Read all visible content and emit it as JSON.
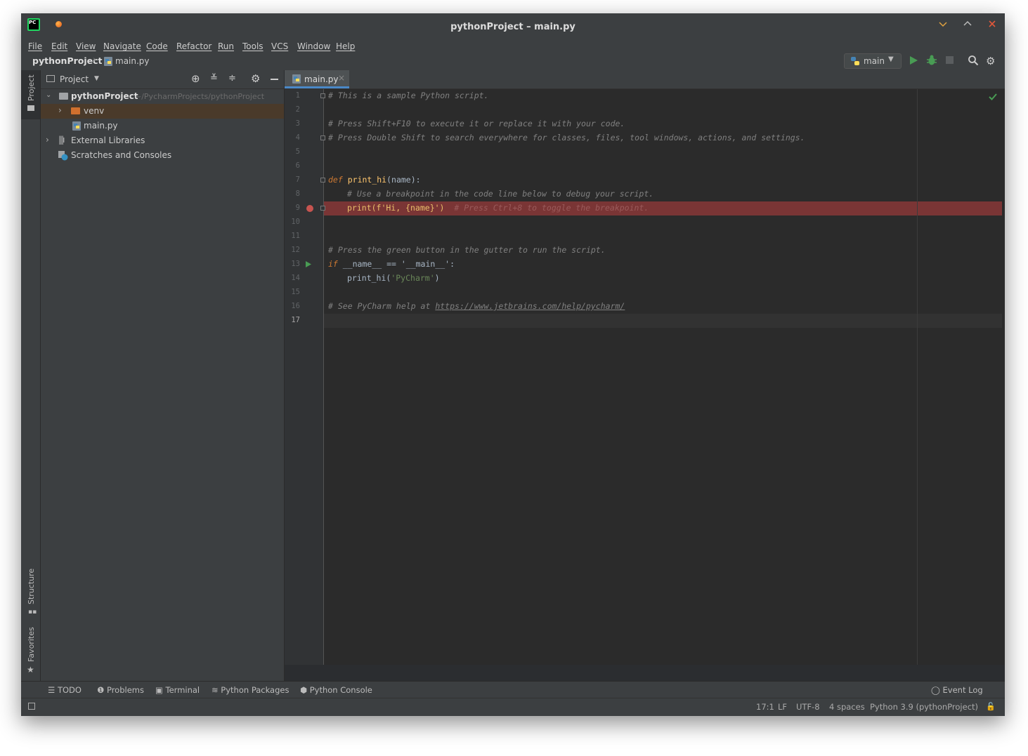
{
  "window": {
    "title": "pythonProject – main.py"
  },
  "menu": [
    "File",
    "Edit",
    "View",
    "Navigate",
    "Code",
    "Refactor",
    "Run",
    "Tools",
    "VCS",
    "Window",
    "Help"
  ],
  "breadcrumb": {
    "project": "pythonProject",
    "file": "main.py"
  },
  "run_config": {
    "label": "main"
  },
  "project_panel": {
    "header": "Project",
    "root": {
      "name": "pythonProject",
      "path": "~/PycharmProjects/pythonProject"
    },
    "items": [
      {
        "label": "venv"
      },
      {
        "label": "main.py"
      },
      {
        "label": "External Libraries"
      },
      {
        "label": "Scratches and Consoles"
      }
    ]
  },
  "side_tabs": {
    "project": "Project",
    "structure": "Structure",
    "favorites": "Favorites"
  },
  "editor": {
    "tab": "main.py",
    "line_numbers": [
      "1",
      "2",
      "3",
      "4",
      "5",
      "6",
      "7",
      "8",
      "9",
      "10",
      "11",
      "12",
      "13",
      "14",
      "15",
      "16",
      "17"
    ],
    "code": {
      "l1": "# This is a sample Python script.",
      "l3": "# Press Shift+F10 to execute it or replace it with your code.",
      "l4": "# Press Double Shift to search everywhere for classes, files, tool windows, actions, and settings.",
      "l7_kw": "def",
      "l7_fn": "print_hi",
      "l7_rest": "(name):",
      "l8": "# Use a breakpoint in the code line below to debug your script.",
      "l9_code": "print(f'Hi, {name}')",
      "l9_cmt": "# Press Ctrl+8 to toggle the breakpoint.",
      "l12": "# Press the green button in the gutter to run the script.",
      "l13_kw": "if",
      "l13_rest": " __name__ == '__main__':",
      "l14_fn": "print_hi",
      "l14_str": "'PyCharm'",
      "l16_cmt": "# See PyCharm help at ",
      "l16_link": "https://www.jetbrains.com/help/pycharm/"
    }
  },
  "bottom_tools": [
    "TODO",
    "Problems",
    "Terminal",
    "Python Packages",
    "Python Console"
  ],
  "event_log": "Event Log",
  "status": {
    "position": "17:1",
    "line_sep": "LF",
    "encoding": "UTF-8",
    "indent": "4 spaces",
    "interpreter": "Python 3.9 (pythonProject)"
  },
  "colors": {
    "accent": "#4a88c7",
    "breakpoint_line": "#7a3535",
    "run_green": "#499c54",
    "folder_orange": "#d0702e"
  }
}
